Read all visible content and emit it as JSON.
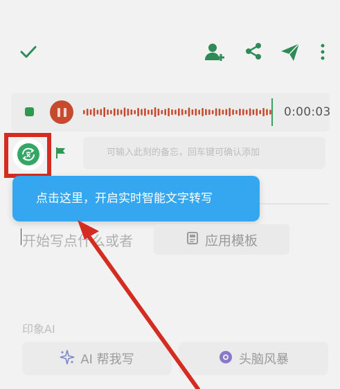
{
  "toolbar": {
    "icons": [
      "check-icon",
      "add-person-icon",
      "share-icon",
      "send-icon",
      "more-vertical-icon"
    ],
    "accent_color": "#2e8b57"
  },
  "recorder": {
    "elapsed": "0:00:03",
    "pause_color": "#c64a2e",
    "wave_color": "#c64a2e"
  },
  "marker": {
    "placeholder": "可输入此刻的备忘，回车键可确认添加"
  },
  "tooltip": {
    "text": "点击这里，开启实时智能文字转写",
    "color": "#35a7f0"
  },
  "editor": {
    "placeholder": "开始写点什么或者",
    "template_button": "应用模板"
  },
  "ai": {
    "section_label": "印象AI",
    "write_button": "AI 帮我写",
    "brainstorm_button": "头脑风暴"
  },
  "annotation": {
    "highlight_color": "#d52c22"
  }
}
